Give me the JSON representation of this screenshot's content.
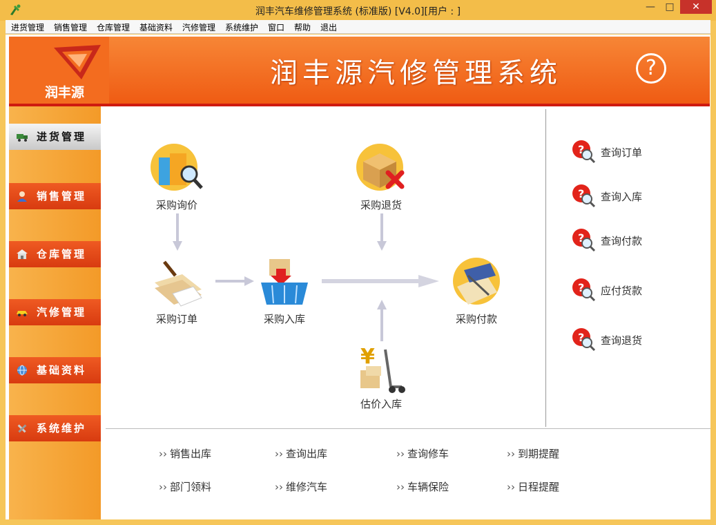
{
  "window": {
    "title": "润丰汽车维修管理系统 (标准版) [V4.0][用户 : ]",
    "min_icon": "minimize-icon",
    "max_icon": "maximize-icon",
    "close_label": "✕"
  },
  "menu": {
    "items": [
      "进货管理",
      "销售管理",
      "仓库管理",
      "基础资料",
      "汽修管理",
      "系统维护",
      "窗口",
      "帮助",
      "退出"
    ]
  },
  "banner": {
    "logo_text": "润丰源",
    "title": "润丰源汽修管理系统",
    "help_glyph": "?"
  },
  "sidenav": {
    "items": [
      {
        "label": "进货管理",
        "icon": "truck-icon"
      },
      {
        "label": "销售管理",
        "icon": "sales-person-icon"
      },
      {
        "label": "仓库管理",
        "icon": "warehouse-icon"
      },
      {
        "label": "汽修管理",
        "icon": "car-icon"
      },
      {
        "label": "基础资料",
        "icon": "globe-icon"
      },
      {
        "label": "系统维护",
        "icon": "tools-icon"
      }
    ],
    "active_index": 0
  },
  "flow": {
    "inquiry": "采购询价",
    "order": "采购订单",
    "return": "采购退货",
    "receive": "采购入库",
    "payment": "采购付款",
    "estimate": "估价入库"
  },
  "queries": [
    "查询订单",
    "查询入库",
    "查询付款",
    "应付货款",
    "查询退货"
  ],
  "bottom_links": {
    "row1": [
      "销售出库",
      "查询出库",
      "查询修车",
      "到期提醒"
    ],
    "row2": [
      "部门领料",
      "维修汽车",
      "车辆保险",
      "日程提醒"
    ],
    "chevron": "››"
  },
  "colors": {
    "banner_orange": "#ef5a12",
    "nav_red": "#d83b10",
    "accent_red": "#cf1a10"
  }
}
